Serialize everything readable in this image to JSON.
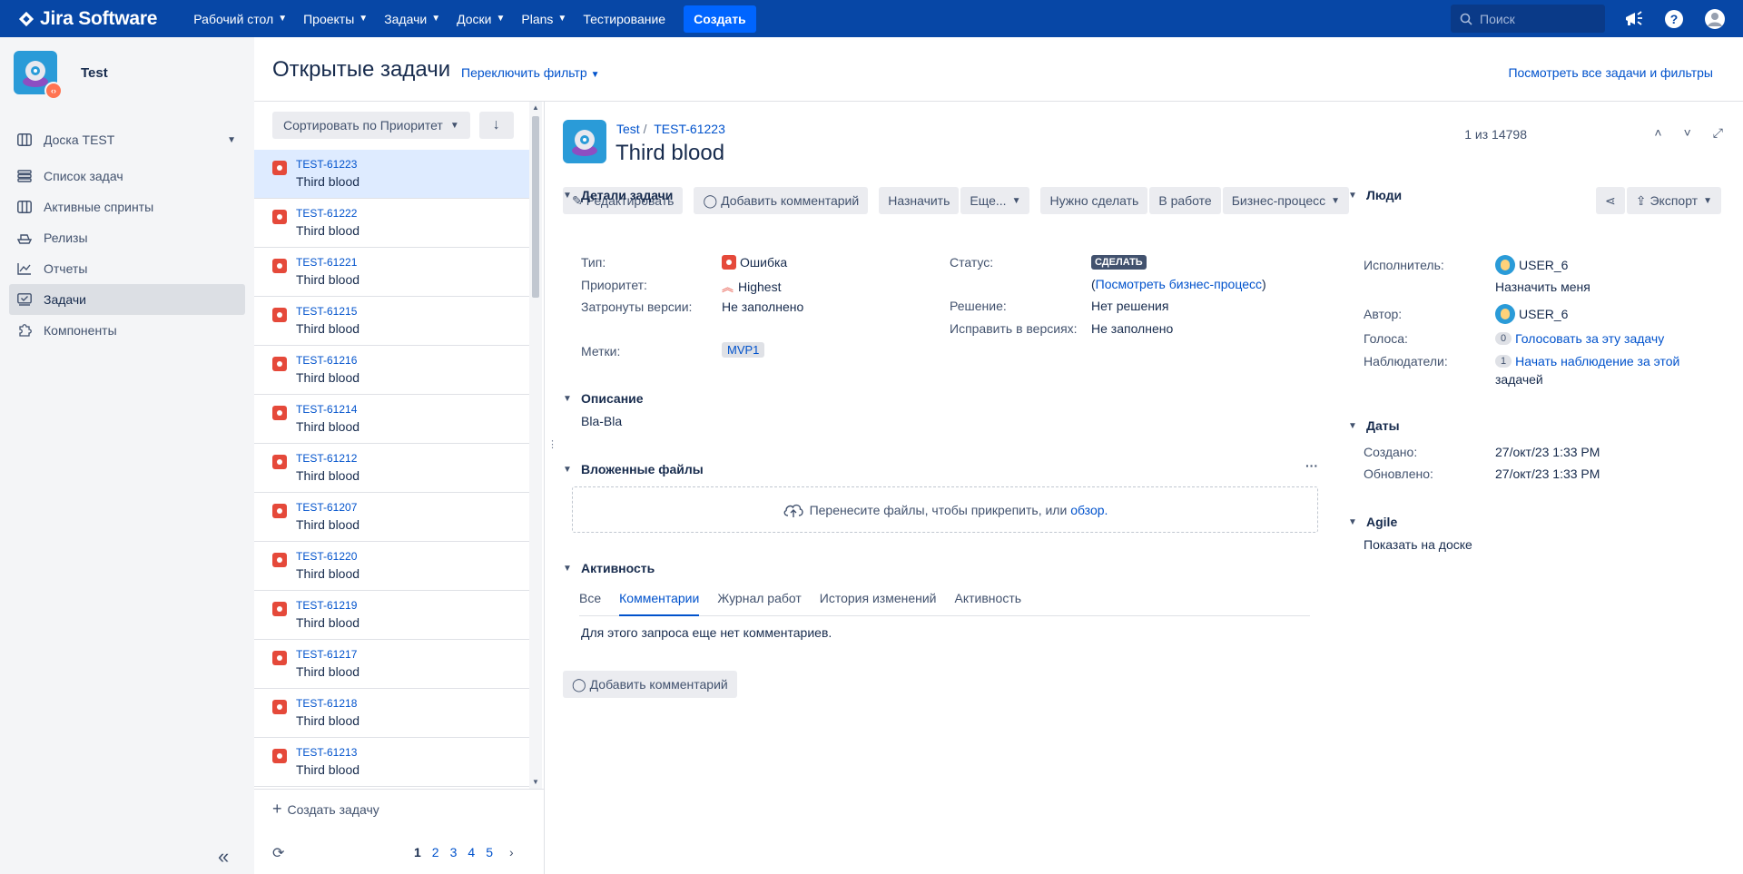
{
  "topnav": {
    "logo": "Jira Software",
    "items": [
      {
        "label": "Рабочий стол",
        "dropdown": true
      },
      {
        "label": "Проекты",
        "dropdown": true
      },
      {
        "label": "Задачи",
        "dropdown": true
      },
      {
        "label": "Доски",
        "dropdown": true
      },
      {
        "label": "Plans",
        "dropdown": true
      },
      {
        "label": "Тестирование",
        "dropdown": false
      }
    ],
    "create": "Создать",
    "search_placeholder": "Поиск"
  },
  "sidebar": {
    "project_name": "Test",
    "board": "Доска TEST",
    "items": [
      {
        "label": "Список задач",
        "icon": "backlog-icon"
      },
      {
        "label": "Активные спринты",
        "icon": "sprint-board-icon"
      },
      {
        "label": "Релизы",
        "icon": "ship-icon"
      },
      {
        "label": "Отчеты",
        "icon": "chart-icon"
      },
      {
        "label": "Задачи",
        "icon": "issues-icon",
        "active": true
      },
      {
        "label": "Компоненты",
        "icon": "puzzle-icon"
      }
    ]
  },
  "header": {
    "title": "Открытые задачи",
    "switch_filter": "Переключить фильтр",
    "view_all": "Посмотреть все задачи и фильтры"
  },
  "list": {
    "sort_label": "Сортировать по Приоритет",
    "issues": [
      {
        "key": "TEST-61223",
        "summary": "Third blood",
        "selected": true
      },
      {
        "key": "TEST-61222",
        "summary": "Third blood"
      },
      {
        "key": "TEST-61221",
        "summary": "Third blood"
      },
      {
        "key": "TEST-61215",
        "summary": "Third blood"
      },
      {
        "key": "TEST-61216",
        "summary": "Third blood"
      },
      {
        "key": "TEST-61214",
        "summary": "Third blood"
      },
      {
        "key": "TEST-61212",
        "summary": "Third blood"
      },
      {
        "key": "TEST-61207",
        "summary": "Third blood"
      },
      {
        "key": "TEST-61220",
        "summary": "Third blood"
      },
      {
        "key": "TEST-61219",
        "summary": "Third blood"
      },
      {
        "key": "TEST-61217",
        "summary": "Third blood"
      },
      {
        "key": "TEST-61218",
        "summary": "Third blood"
      },
      {
        "key": "TEST-61213",
        "summary": "Third blood"
      }
    ],
    "create_issue": "Создать задачу",
    "pages": [
      "1",
      "2",
      "3",
      "4",
      "5"
    ]
  },
  "detail": {
    "project": "Test",
    "key": "TEST-61223",
    "title": "Third blood",
    "position": "1 из 14798",
    "toolbar": {
      "edit": "Редактировать",
      "comment": "Добавить комментарий",
      "assign": "Назначить",
      "more": "Еще...",
      "todo": "Нужно сделать",
      "in_progress": "В работе",
      "workflow": "Бизнес-процесс",
      "export": "Экспорт"
    },
    "details": {
      "heading": "Детали задачи",
      "type_label": "Тип:",
      "type_value": "Ошибка",
      "priority_label": "Приоритет:",
      "priority_value": "Highest",
      "affects_label": "Затронуты версии:",
      "affects_value": "Не заполнено",
      "labels_label": "Метки:",
      "labels_value": "MVP1",
      "status_label": "Статус:",
      "status_value": "СДЕЛАТЬ",
      "workflow_link_open": "(",
      "workflow_link": "Посмотреть бизнес-процесс",
      "workflow_link_close": ")",
      "resolution_label": "Решение:",
      "resolution_value": "Нет решения",
      "fix_label": "Исправить в версиях:",
      "fix_value": "Не заполнено"
    },
    "description": {
      "heading": "Описание",
      "text": "Bla-Bla"
    },
    "attachments": {
      "heading": "Вложенные файлы",
      "drop_text": "Перенесите файлы, чтобы прикрепить, или",
      "browse": "обзор."
    },
    "activity": {
      "heading": "Активность",
      "tabs": [
        "Все",
        "Комментарии",
        "Журнал работ",
        "История изменений",
        "Активность"
      ],
      "empty": "Для этого запроса еще нет комментариев.",
      "add_comment": "Добавить комментарий"
    },
    "people": {
      "heading": "Люди",
      "assignee_label": "Исполнитель:",
      "assignee": "USER_6",
      "assign_me": "Назначить меня",
      "reporter_label": "Автор:",
      "reporter": "USER_6",
      "votes_label": "Голоса:",
      "votes_count": "0",
      "vote_link": "Голосовать за эту задачу",
      "watchers_label": "Наблюдатели:",
      "watchers_count": "1",
      "watch_link_1": "Начать наблюдение за этой",
      "watch_link_2": "задачей"
    },
    "dates": {
      "heading": "Даты",
      "created_label": "Создано:",
      "created": "27/окт/23 1:33 PM",
      "updated_label": "Обновлено:",
      "updated": "27/окт/23 1:33 PM"
    },
    "agile": {
      "heading": "Agile",
      "link": "Показать на доске"
    }
  },
  "colors": {
    "nav_bg": "#0747a6",
    "accent": "#0052cc",
    "bug": "#e5493a",
    "selected_row": "#deebff"
  }
}
